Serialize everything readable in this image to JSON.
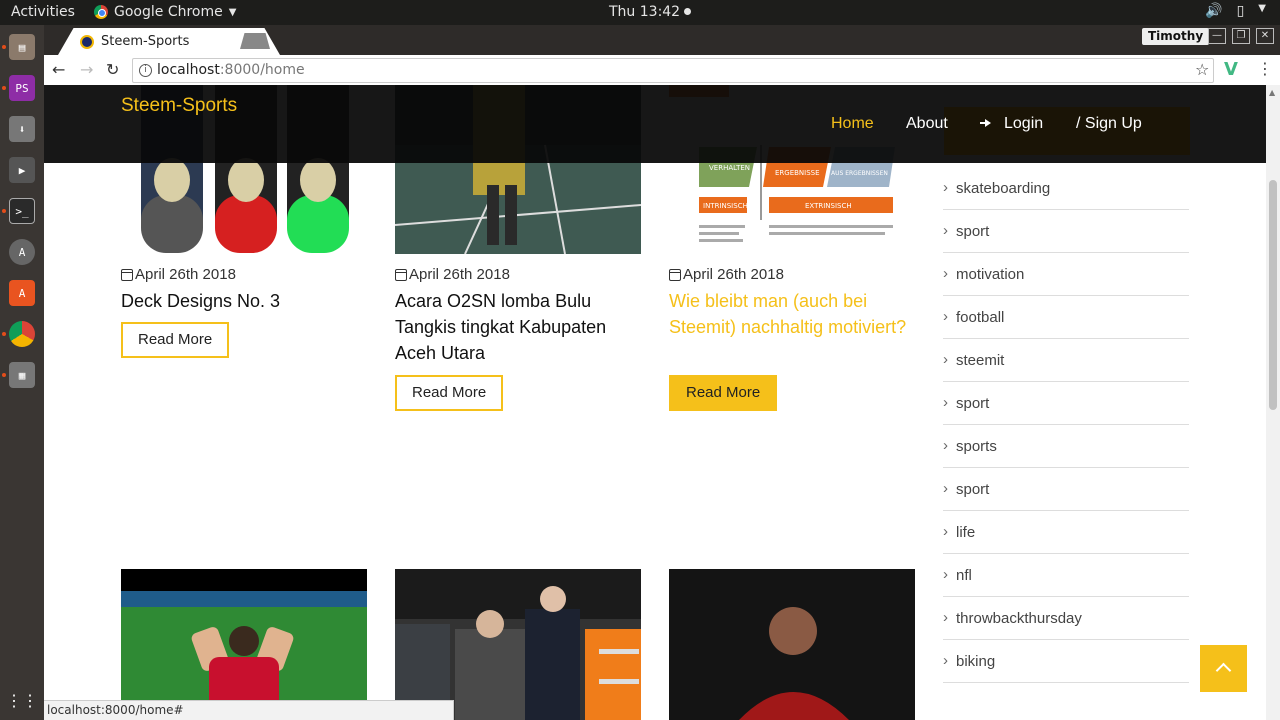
{
  "system": {
    "activities": "Activities",
    "app_name": "Google Chrome",
    "clock": "Thu 13:42"
  },
  "browser": {
    "tab_title": "Steem-Sports",
    "profile": "Timothy",
    "url_host": "localhost",
    "url_rest": ":8000/home",
    "status_url": "localhost:8000/home#"
  },
  "site": {
    "brand": "Steem-Sports",
    "nav": {
      "home": "Home",
      "about": "About",
      "login": "Login",
      "signup": "/ Sign Up"
    },
    "accent": "#f5c01a"
  },
  "posts": [
    {
      "date": "April 26th 2018",
      "title": "Deck Designs No. 3",
      "button": "Read More"
    },
    {
      "date": "April 26th 2018",
      "title": "Acara O2SN lomba Bulu Tangkis tingkat Kabupaten Aceh Utara",
      "button": "Read More"
    },
    {
      "date": "April 26th 2018",
      "title": "Wie bleibt man (auch bei Steemit) nachhaltig motiviert?",
      "button": "Read More"
    }
  ],
  "tags": [
    "skateboarding",
    "sport",
    "motivation",
    "football",
    "steemit",
    "sport",
    "sports",
    "sport",
    "life",
    "nfl",
    "throwbackthursday",
    "biking"
  ],
  "thumb_text": {
    "c1": "VERHALTEN",
    "c2": "ERGEBNISSE",
    "c3": "AUS ERGEBNISSEN",
    "c4": "INTRINSISCH",
    "c5": "EXTRINSISCH"
  }
}
